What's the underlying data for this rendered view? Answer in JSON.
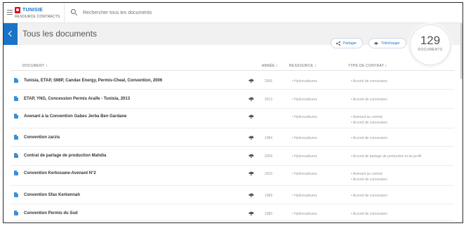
{
  "brand": {
    "country": "TUNISIE",
    "subtitle": "RESOURCE CONTRACTS"
  },
  "search": {
    "placeholder": "Rechercher tous les documents"
  },
  "page": {
    "title": "Tous les documents"
  },
  "actions": {
    "share": "Partager",
    "download": "Télécharger"
  },
  "counter": {
    "value": "129",
    "label": "DOCUMENTS"
  },
  "table": {
    "headers": {
      "document": "DOCUMENT ↕",
      "annee": "ANNÉE ↕",
      "ressource": "RESSOURCE ↕",
      "type": "TYPE DE CONTRAT ↕"
    },
    "rows": [
      {
        "name": "Tunisia, ETAP, SMIP, Candax Energy, Permis-Cheal, Convention, 2006",
        "year": "2006",
        "resource": "• Hydrocarbures",
        "types": [
          "• Accord de concession"
        ]
      },
      {
        "name": "ETAP, YNG, Concession Permis Araife - Tunisia, 2013",
        "year": "2013",
        "resource": "• Hydrocarbures",
        "types": [
          "• Accord de concession"
        ]
      },
      {
        "name": "Avenant à la Convention Gabes Jerba Ben Gardane",
        "year": "",
        "resource": "• Hydrocarbures",
        "types": [
          "• Avenant au contrat",
          "• Accord de concession"
        ]
      },
      {
        "name": "Convention zarzis",
        "year": "1984",
        "resource": "• Hydrocarbures",
        "types": [
          "• Accord de concession"
        ]
      },
      {
        "name": "Contrat de partage de production Mahdia",
        "year": "2009",
        "resource": "• Hydrocarbures",
        "types": [
          "• Accord de partage de production et du profit"
        ]
      },
      {
        "name": "Convention Kerkouane-Avenant N°2",
        "year": "2010",
        "resource": "• Hydrocarbures",
        "types": [
          "• Avenant au contrat",
          "• Accord de concession"
        ]
      },
      {
        "name": "Convention Sfax Kerkennah",
        "year": "1989",
        "resource": "• Hydrocarbures",
        "types": [
          "• Accord de concession"
        ]
      },
      {
        "name": "Convention Permis du Sud",
        "year": "1980",
        "resource": "• Hydrocarbures",
        "types": [
          "• Accord de concession"
        ]
      }
    ]
  },
  "colors": {
    "accent": "#1a73c8",
    "flag": "#e30a17"
  },
  "icons": {
    "menu": "menu-icon",
    "search": "search-icon",
    "back": "chevron-left-icon",
    "share": "share-icon",
    "download": "cloud-download-icon",
    "document": "document-icon"
  }
}
